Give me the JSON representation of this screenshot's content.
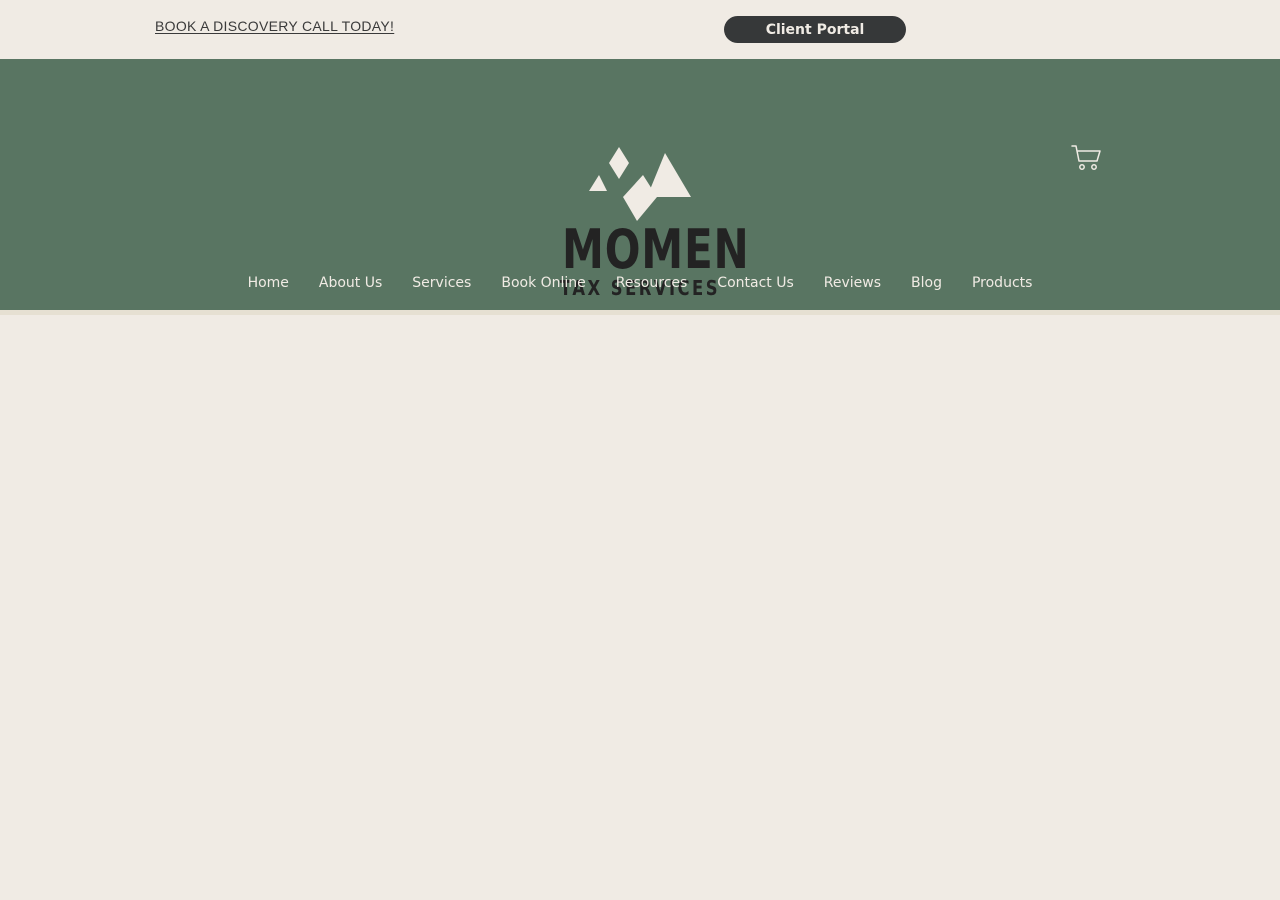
{
  "topbar": {
    "discovery_link": "BOOK A DISCOVERY CALL TODAY!",
    "client_portal_button": "Client Portal"
  },
  "header": {
    "logo": {
      "wordmark": "MOMEN",
      "subtitle": "TAX SERVICES"
    },
    "cart_icon": "cart-icon",
    "nav": {
      "items": [
        {
          "label": "Home"
        },
        {
          "label": "About Us"
        },
        {
          "label": "Services"
        },
        {
          "label": "Book Online"
        },
        {
          "label": "Resources"
        },
        {
          "label": "Contact Us"
        },
        {
          "label": "Reviews"
        },
        {
          "label": "Blog"
        },
        {
          "label": "Products"
        }
      ]
    }
  },
  "colors": {
    "background": "#f0ebe4",
    "header_green": "#597562",
    "button_dark": "#363839",
    "logo_text": "#232323"
  }
}
